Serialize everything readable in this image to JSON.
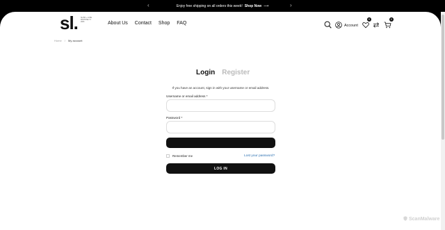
{
  "announcement": {
    "text": "Enjoy free shipping on all orders this week!",
    "link": "Shop Now",
    "link_arrow": "⟶",
    "prev_icon": "chevron-left-icon",
    "next_icon": "chevron-right-icon"
  },
  "logo": {
    "mark": "sl.",
    "tagline": "SLOW + LUXE PANTONE Y1 2023"
  },
  "nav": {
    "items": [
      "About Us",
      "Contact",
      "Shop",
      "FAQ"
    ]
  },
  "header_icons": {
    "account_label": "Account",
    "wishlist_count": "0",
    "cart_count": "0"
  },
  "breadcrumb": {
    "home": "Home",
    "separator": "/",
    "current": "My account"
  },
  "tabs": {
    "login": "Login",
    "register": "Register"
  },
  "form": {
    "intro": "If you have an account, sign in with your username or email address.",
    "username_label": "Username or email address *",
    "username_value": "",
    "password_label": "Password *",
    "password_value": "",
    "remember_label": "Remember me",
    "lost_password": "Lost your password?",
    "login_button": "LOG IN"
  },
  "watermark": {
    "text": "ScanMalware"
  },
  "colors": {
    "background": "#000000",
    "page": "#ffffff",
    "accent": "#111111",
    "link": "#2a6fb0"
  }
}
